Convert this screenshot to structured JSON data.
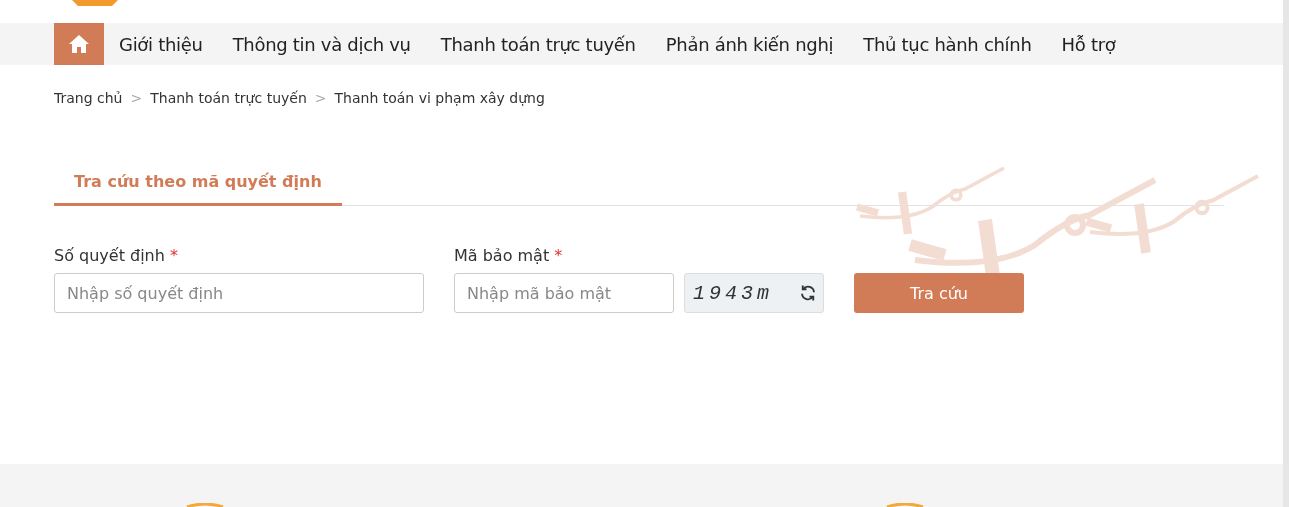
{
  "nav": {
    "items": [
      "Giới thiệu",
      "Thông tin và dịch vụ",
      "Thanh toán trực tuyến",
      "Phản ánh kiến nghị",
      "Thủ tục hành chính",
      "Hỗ trợ"
    ]
  },
  "breadcrumb": {
    "items": [
      "Trang chủ",
      "Thanh toán trực tuyến",
      "Thanh toán vi phạm xây dựng"
    ],
    "separator": ">"
  },
  "tabs": [
    {
      "label": "Tra cứu theo mã quyết định",
      "selected": true
    }
  ],
  "form": {
    "fields": [
      {
        "label": "Số quyết định",
        "required_mark": "*",
        "placeholder": "Nhập số quyết định",
        "kind": "text"
      },
      {
        "label": "Mã bảo mật",
        "required_mark": "*",
        "placeholder": "Nhập mã bảo mật",
        "kind": "captcha",
        "captcha": "1943m"
      }
    ],
    "submit": "Tra cứu"
  }
}
